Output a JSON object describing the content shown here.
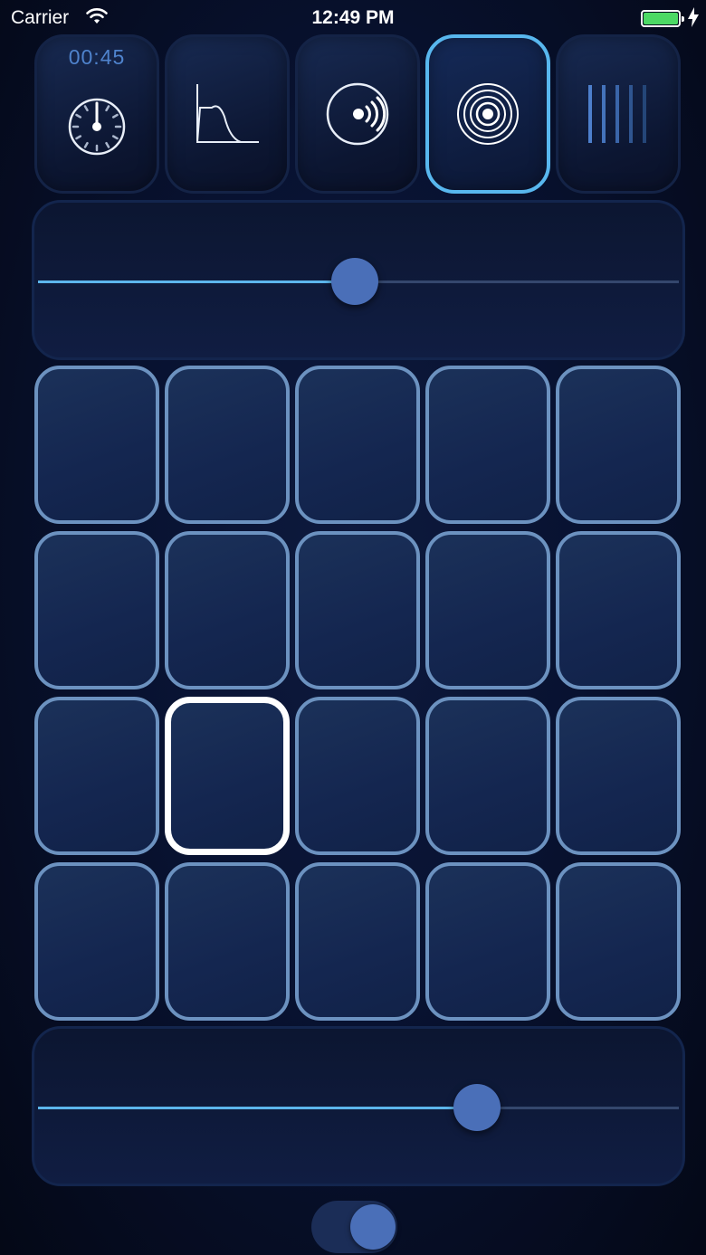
{
  "status_bar": {
    "carrier": "Carrier",
    "time": "12:49 PM",
    "battery_color": "#4cd964"
  },
  "modes": [
    {
      "name": "timer",
      "icon": "stopwatch-icon",
      "label": "00:45",
      "active": false
    },
    {
      "name": "envelope",
      "icon": "envelope-curve-icon",
      "active": false
    },
    {
      "name": "broadcast",
      "icon": "sound-waves-icon",
      "active": false
    },
    {
      "name": "target",
      "icon": "concentric-rings-icon",
      "active": true
    },
    {
      "name": "bars",
      "icon": "vertical-bars-icon",
      "active": false
    }
  ],
  "top_slider": {
    "value_percent": 49.5
  },
  "pads": {
    "rows": 4,
    "columns": 5,
    "selected": {
      "row": 3,
      "column": 2
    }
  },
  "bottom_slider": {
    "value_percent": 68.5
  },
  "toggle": {
    "on": true
  },
  "colors": {
    "accent": "#58b7ee",
    "pad_border": "#6c92c0",
    "thumb": "#4a6fb8",
    "timer_text": "#4f83cd"
  }
}
